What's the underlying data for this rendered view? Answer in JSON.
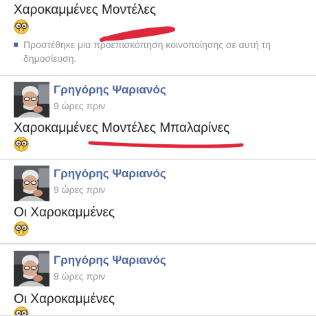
{
  "posts": [
    {
      "text": "Χαροκαμμένες Μοντέλες",
      "emoji": "nerd-glasses-emoji",
      "note": "Προστέθηκε μια προεπισκόπηση κοινοποίησης σε αυτή τη δημοσίευση."
    },
    {
      "author": "Γρηγόρης Ψαριανός",
      "time": "9 ώρες πριν",
      "text": "Χαροκαμμένες Μοντέλες Μπαλαρίνες",
      "emoji": "nerd-glasses-emoji"
    },
    {
      "author": "Γρηγόρης Ψαριανός",
      "time": "9 ώρες πριν",
      "text": "Οι Χαροκαμμένες",
      "emoji": "nerd-glasses-emoji"
    },
    {
      "author": "Γρηγόρης Ψαριανός",
      "time": "9 ώρες πριν",
      "text": "Οι Χαροκαμμένες",
      "emoji": "nerd-glasses-emoji"
    }
  ],
  "colors": {
    "author_link": "#4b67a1",
    "secondary_text": "#90949c",
    "highlight_marker": "#e0263a"
  }
}
